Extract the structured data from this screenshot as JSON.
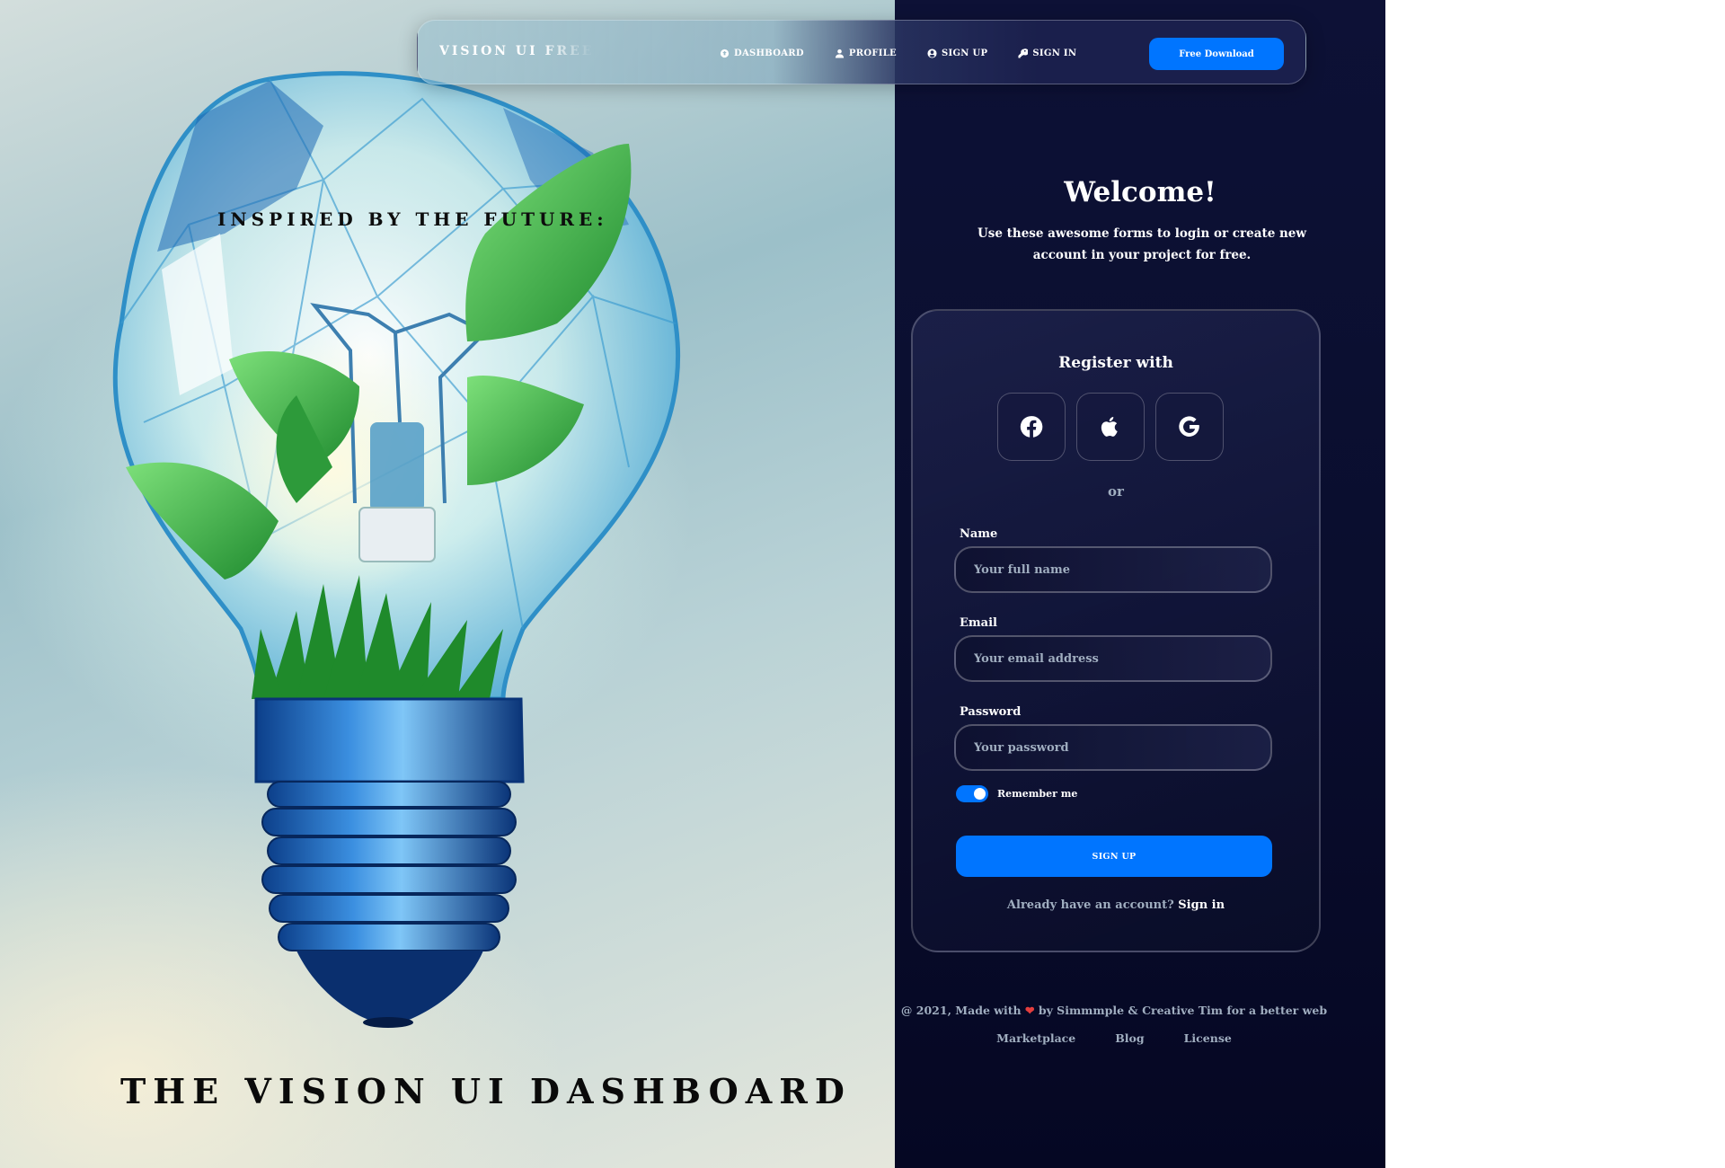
{
  "hero": {
    "kicker": "INSPIRED BY THE FUTURE:",
    "title": "THE VISION UI DASHBOARD",
    "illustration": "lightbulb-with-plant"
  },
  "navbar": {
    "brand": "VISION UI FREE",
    "links": [
      {
        "label": "DASHBOARD",
        "icon": "dashboard-icon"
      },
      {
        "label": "PROFILE",
        "icon": "person-icon"
      },
      {
        "label": "SIGN UP",
        "icon": "user-circle-icon"
      },
      {
        "label": "SIGN IN",
        "icon": "key-icon"
      }
    ],
    "cta_label": "Free Download"
  },
  "welcome": {
    "title": "Welcome!",
    "subtitle": "Use these awesome forms to login or create new account in your project for free."
  },
  "card": {
    "title": "Register with",
    "socials": [
      "facebook-icon",
      "apple-icon",
      "google-icon"
    ],
    "divider": "or",
    "fields": {
      "name": {
        "label": "Name",
        "placeholder": "Your full name",
        "value": ""
      },
      "email": {
        "label": "Email",
        "placeholder": "Your email address",
        "value": ""
      },
      "password": {
        "label": "Password",
        "placeholder": "Your password",
        "value": ""
      }
    },
    "remember": {
      "label": "Remember me",
      "checked": true
    },
    "submit_label": "SIGN UP",
    "already_text": "Already have an account?",
    "signin_label": "Sign in"
  },
  "footer": {
    "copy_before": "@ 2021, Made with",
    "copy_after": "by Simmmple & Creative Tim for a better web",
    "links": [
      "Marketplace",
      "Blog",
      "License"
    ]
  },
  "colors": {
    "accent": "#0075ff",
    "panel_bg": "#0a0e2e",
    "muted_text": "#a0aec0",
    "heart": "#e53e3e"
  }
}
